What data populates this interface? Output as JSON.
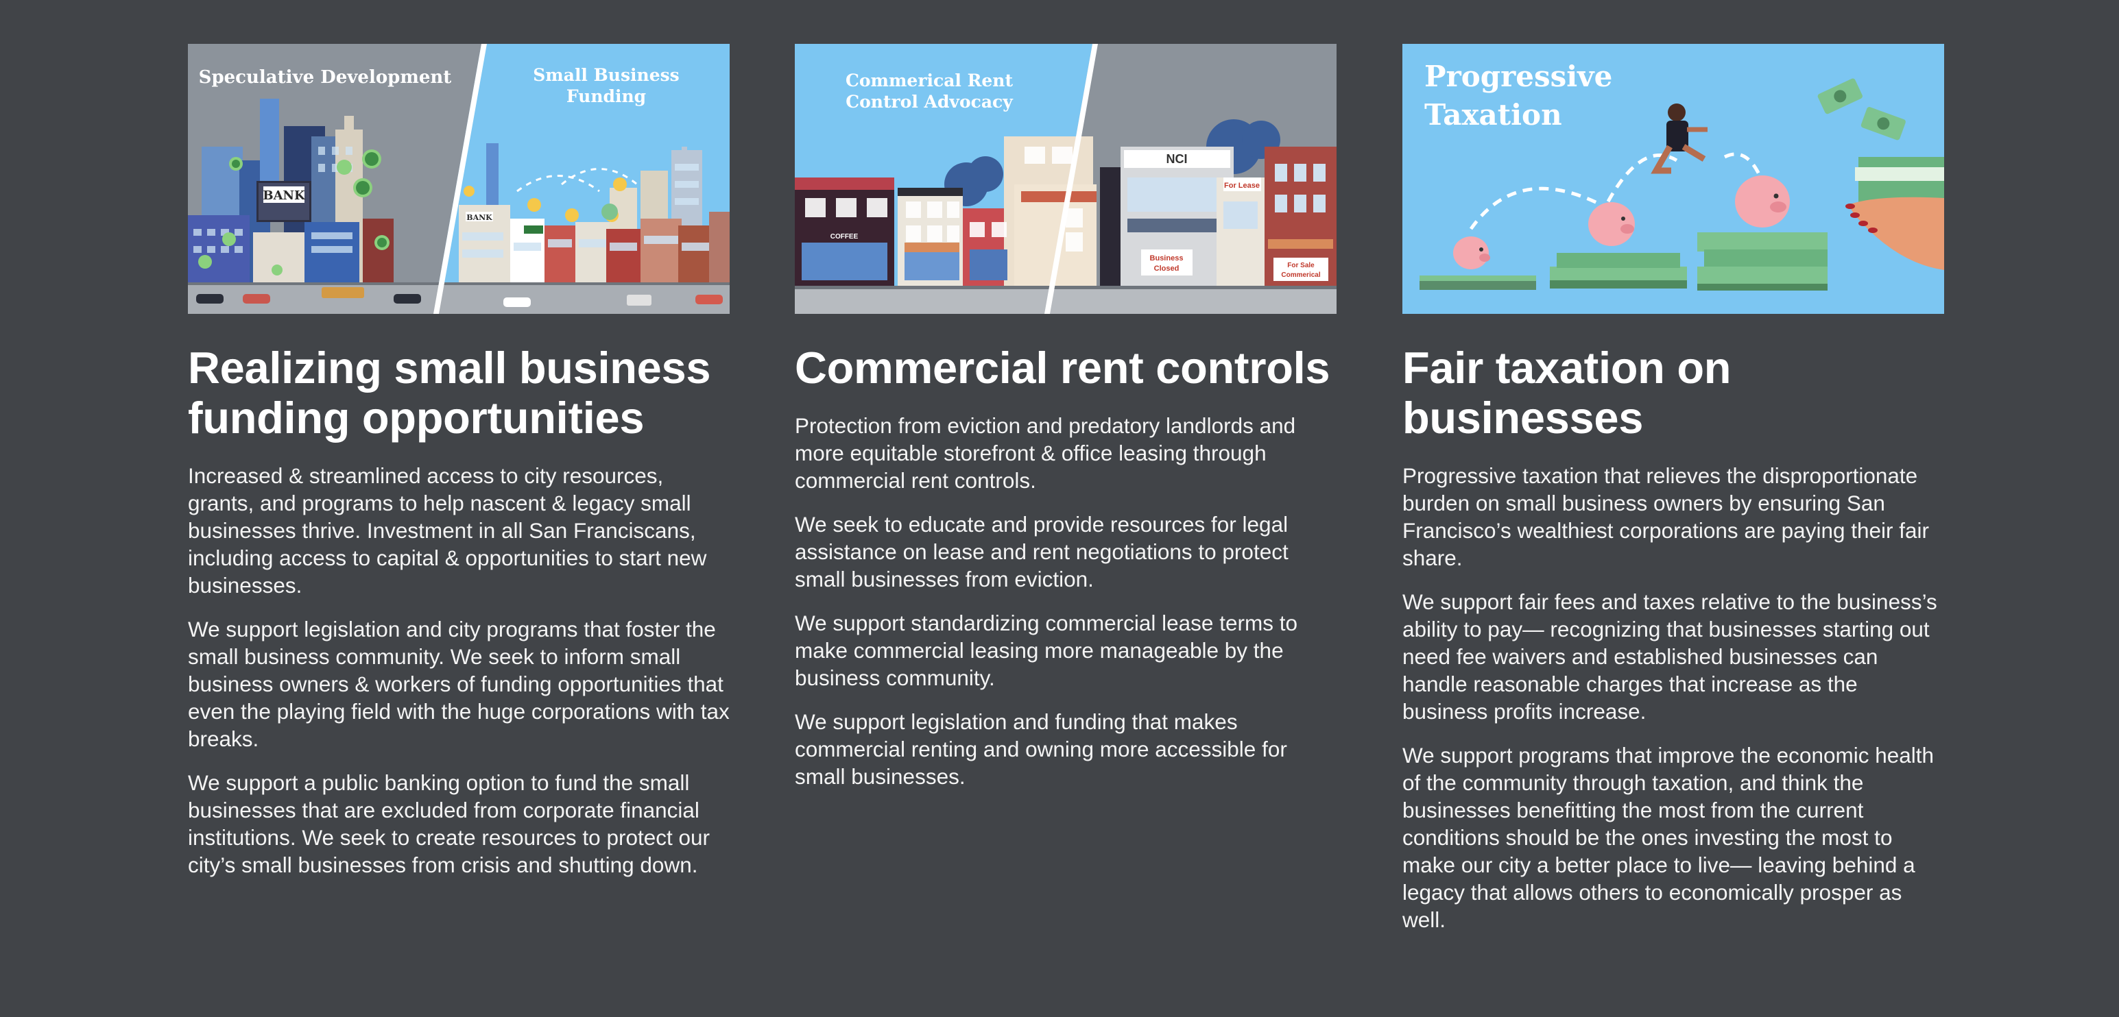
{
  "columns": [
    {
      "image_captions": [
        "Speculative Development",
        "Small Business",
        "Funding"
      ],
      "image_signs": [
        "BANK",
        "BANK",
        "$$"
      ],
      "title": "Realizing small business funding opportunities",
      "paragraphs": [
        "Increased & streamlined access to city resources, grants, and programs to help nascent & legacy small businesses thrive. Investment in all San Franciscans, including access to capital & opportunities to start new businesses.",
        "We support legislation and city programs that foster the small business community. We seek to inform small business owners & workers of funding opportunities that even the playing field with the huge corporations with tax breaks.",
        "We support a public banking option to fund the small businesses that are excluded from corporate financial institutions. We seek to create resources to protect our city’s small businesses from crisis and shutting down."
      ]
    },
    {
      "image_captions": [
        "Commerical Rent",
        "Control Advocacy"
      ],
      "image_signs": [
        "NCI",
        "For Lease",
        "Business",
        "Closed",
        "For Sale",
        "Commerical",
        "COFFEE"
      ],
      "title": "Commercial rent controls",
      "paragraphs": [
        "Protection from eviction and predatory landlords and more equitable storefront & office leasing through commercial rent controls.",
        "We seek to educate and provide resources for legal assistance on lease and rent negotiations to protect small businesses from eviction.",
        "We support standardizing commercial lease terms to make commercial leasing more manageable by the business community.",
        "We support legislation and funding that makes commercial renting and owning more accessible for small businesses."
      ]
    },
    {
      "image_captions": [
        "Progressive",
        "Taxation"
      ],
      "title": "Fair taxation on businesses",
      "paragraphs": [
        "Progressive taxation that relieves the disproportionate burden on small business owners by ensuring San Francisco’s wealthiest corporations are paying their fair share.",
        "We support fair fees and taxes relative to the business’s ability to pay— recognizing that businesses starting out need fee waivers and established businesses can handle reasonable charges that increase as the business profits increase.",
        "We support programs that improve the economic health of the community through taxation, and think the businesses benefitting the most from the current conditions should be the ones investing the most to make our city a better place to live— leaving behind a legacy that allows others to economically prosper as well."
      ]
    }
  ],
  "colors": {
    "background": "#414448",
    "text": "#ffffff",
    "sky_blue": "#7cc6f2",
    "sky_gray": "#8c939b",
    "money_green": "#7ec38f"
  }
}
